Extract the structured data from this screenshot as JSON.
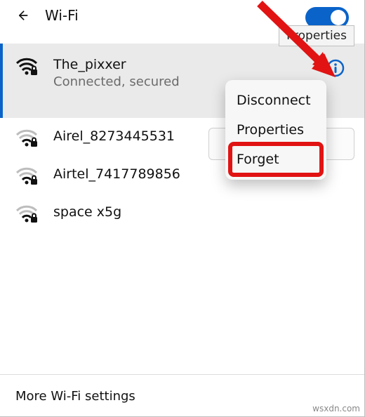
{
  "header": {
    "title": "Wi-Fi",
    "tooltip": "Properties"
  },
  "connected": {
    "name": "The_pixxer",
    "status": "Connected, secured"
  },
  "networks": [
    {
      "name": "Airel_8273445531"
    },
    {
      "name": "Airtel_7417789856"
    },
    {
      "name": "space x5g"
    }
  ],
  "menu": {
    "disconnect": "Disconnect",
    "properties": "Properties",
    "forget": "Forget"
  },
  "footer": {
    "more": "More Wi-Fi settings"
  },
  "watermark": "wsxdn.com"
}
